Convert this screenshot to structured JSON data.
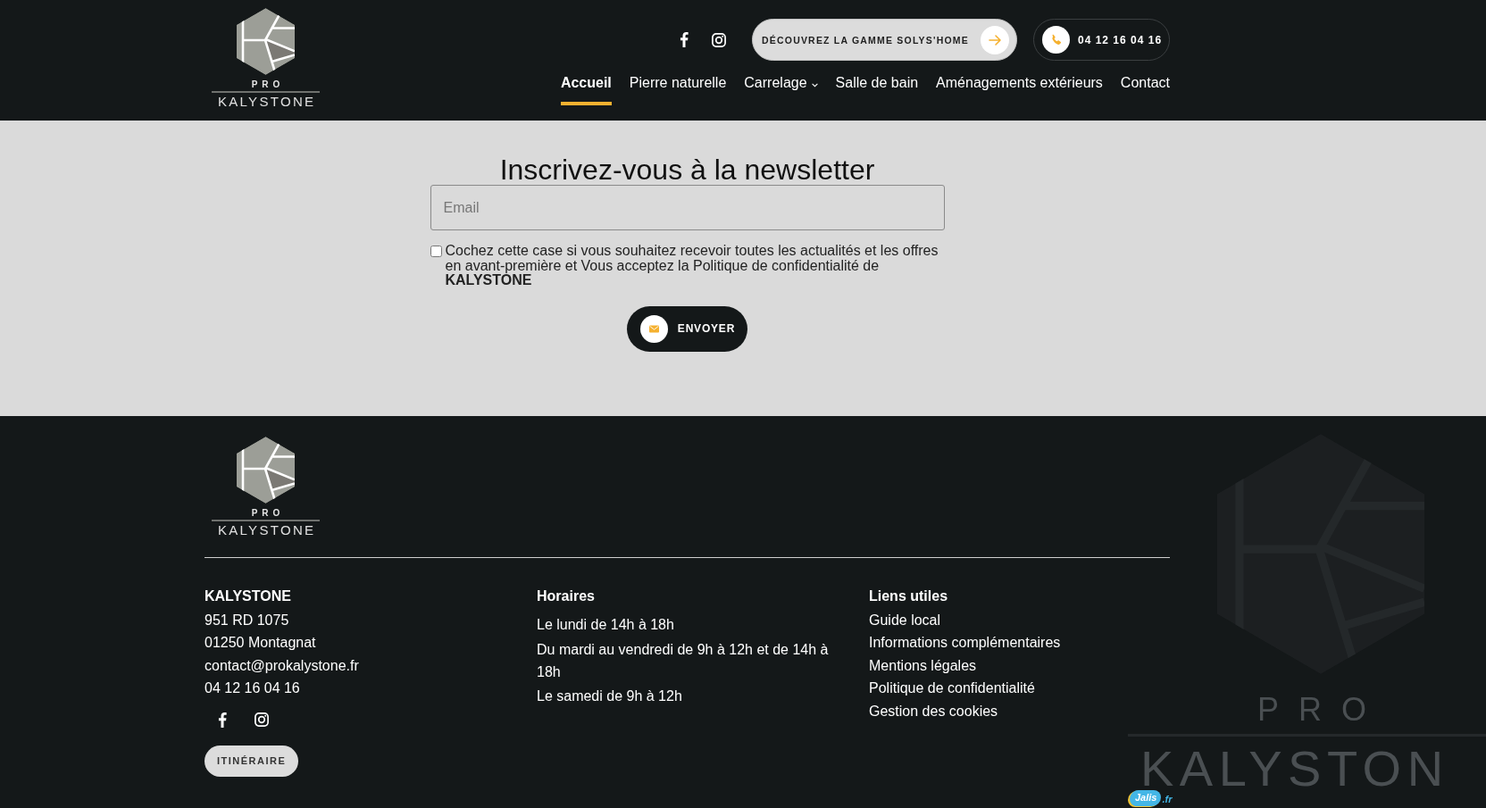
{
  "header": {
    "logo": {
      "top": "PRO",
      "bottom": "KALYSTONE"
    },
    "social": [
      {
        "kind": "facebook"
      },
      {
        "kind": "instagram"
      }
    ],
    "cta_button": {
      "label": "DÉCOUVREZ LA GAMME SOLYS'HOME"
    },
    "phone_button": {
      "label": "04 12 16 04 16"
    },
    "nav": [
      {
        "label": "Accueil",
        "selected": true,
        "submenu": false
      },
      {
        "label": "Pierre naturelle",
        "selected": false,
        "submenu": false
      },
      {
        "label": "Carrelage",
        "selected": false,
        "submenu": true
      },
      {
        "label": "Salle de bain",
        "selected": false,
        "submenu": false
      },
      {
        "label": "Aménagements extérieurs",
        "selected": false,
        "submenu": false
      },
      {
        "label": "Contact",
        "selected": false,
        "submenu": false
      }
    ]
  },
  "newsletter": {
    "title": "Inscrivez-vous à la newsletter",
    "email_field": {
      "placeholder": "Email"
    },
    "consent": {
      "checked": false,
      "text": "Cochez cette case si vous souhaitez recevoir toutes les actualités et les offres en avant-première et Vous acceptez la Politique de confidentialité de **KALYSTONE**"
    },
    "submit_button": {
      "label": "ENVOYER"
    }
  },
  "footer": {
    "logo": {
      "top": "PRO",
      "bottom": "KALYSTONE"
    },
    "contact": {
      "heading": "KALYSTONE",
      "lines": [
        "951 RD 1075",
        "01250 Montagnat",
        "contact@prokalystone.fr",
        "04 12 16 04 16"
      ],
      "social": [
        {
          "kind": "facebook"
        },
        {
          "kind": "instagram"
        }
      ],
      "route_button": {
        "label": "ITINÉRAIRE"
      }
    },
    "hours": {
      "heading": "Horaires",
      "lines": [
        "Le lundi de 14h à 18h",
        "Du mardi au vendredi de 9h à 12h et de 14h à 18h",
        "Le samedi de 9h à 12h"
      ]
    },
    "links": {
      "heading": "Liens utiles",
      "items": [
        "Guide local",
        "Informations complémentaires",
        "Mentions légales",
        "Politique de confidentialité",
        "Gestion des cookies"
      ]
    },
    "background_logo": {
      "top": "PRO",
      "bottom": "KALYSTON"
    },
    "credit_badge": {
      "name": "Jalis",
      "domain": ".fr"
    }
  }
}
